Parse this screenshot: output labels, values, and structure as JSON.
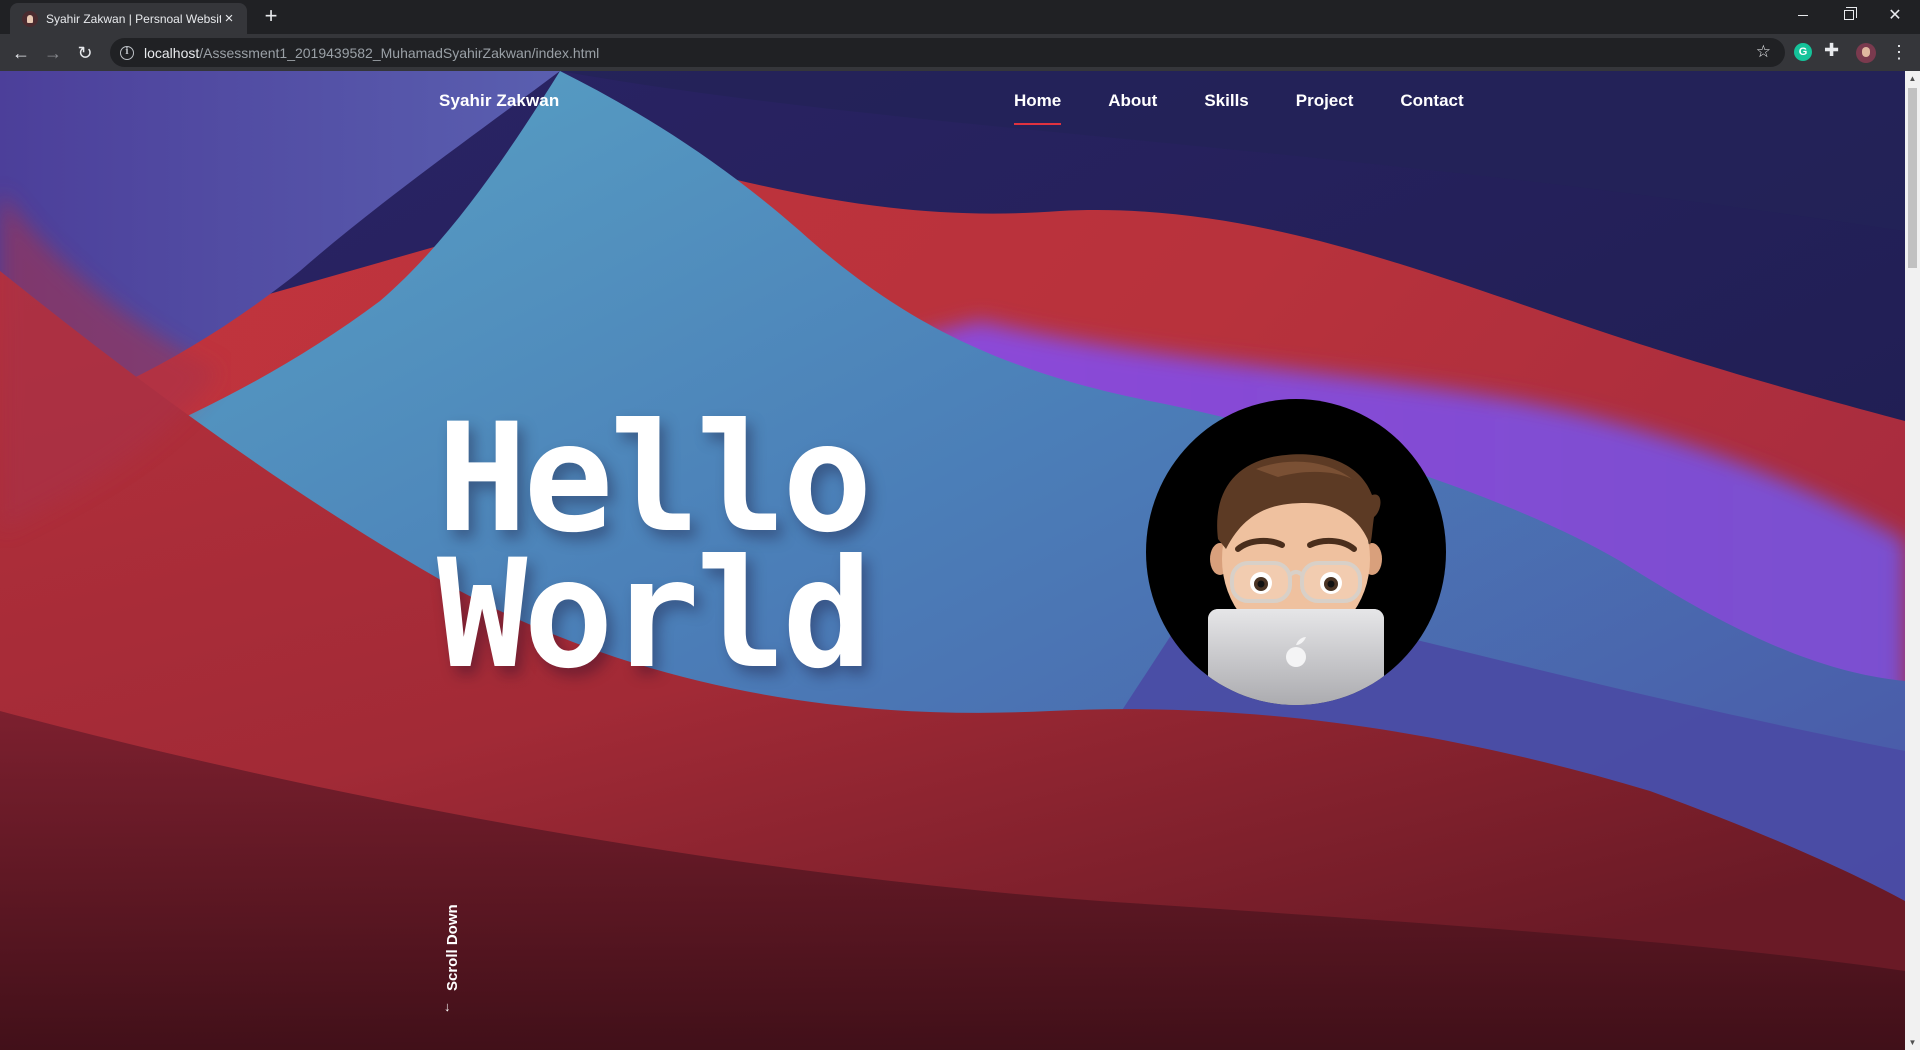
{
  "browser": {
    "tab_title": "Syahir Zakwan | Persnoal Website",
    "tab_close": "×",
    "new_tab": "+",
    "url_host": "localhost",
    "url_path": "/Assessment1_2019439582_MuhamadSyahirZakwan/index.html",
    "extension_letter": "G"
  },
  "site": {
    "brand": "Syahir Zakwan",
    "nav": [
      "Home",
      "About",
      "Skills",
      "Project",
      "Contact"
    ],
    "active_nav": "Home",
    "hero_line1": "Hello",
    "hero_line2": "World",
    "scroll_hint": "Scroll Down"
  },
  "colors": {
    "accent_underline": "#e0323f",
    "nav_text": "#ffffff",
    "avatar_bg": "#000000"
  },
  "icons": [
    "back-arrow-icon",
    "forward-arrow-icon",
    "reload-icon",
    "info-icon",
    "star-icon",
    "grammarly-icon",
    "puzzle-icon",
    "profile-avatar",
    "menu-dots-icon",
    "down-arrow-icon"
  ]
}
